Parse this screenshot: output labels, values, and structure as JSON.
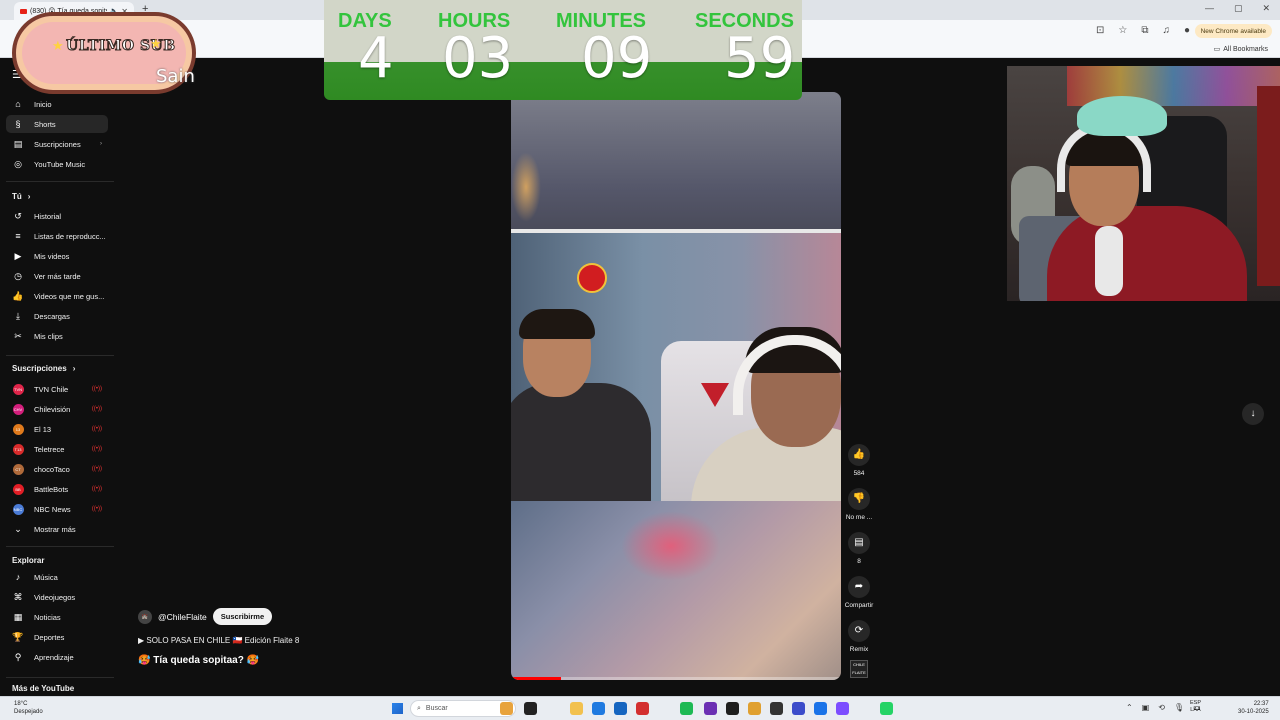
{
  "browser": {
    "tab_title": "(830) 😲 Tía queda sopitsa...",
    "new_chrome": "New Chrome available",
    "all_bookmarks": "All Bookmarks"
  },
  "overlay": {
    "badge_title": "ÚLTIMO SUB",
    "badge_name": "Sain",
    "countdown": {
      "days_label": "DAYS",
      "days": "4",
      "hours_label": "HOURS",
      "hours": "03",
      "minutes_label": "MINUTES",
      "minutes": "09",
      "seconds_label": "SECONDS",
      "seconds": "59"
    }
  },
  "sidebar": {
    "main": [
      {
        "label": "Inicio",
        "icon": "home-icon"
      },
      {
        "label": "Shorts",
        "icon": "shorts-icon"
      },
      {
        "label": "Suscripciones",
        "icon": "subscriptions-icon"
      },
      {
        "label": "YouTube Music",
        "icon": "music-icon"
      }
    ],
    "you_title": "Tú",
    "you": [
      {
        "label": "Historial",
        "icon": "history-icon"
      },
      {
        "label": "Listas de reproducc...",
        "icon": "playlist-icon"
      },
      {
        "label": "Mis videos",
        "icon": "video-icon"
      },
      {
        "label": "Ver más tarde",
        "icon": "clock-icon"
      },
      {
        "label": "Videos que me gus...",
        "icon": "like-icon"
      },
      {
        "label": "Descargas",
        "icon": "download-icon"
      },
      {
        "label": "Mis clips",
        "icon": "scissors-icon"
      }
    ],
    "subs_title": "Suscripciones",
    "subs": [
      {
        "label": "TVN Chile",
        "color": "#e0254a",
        "abbr": "TVN"
      },
      {
        "label": "Chilevisión",
        "color": "#d41e7c",
        "abbr": "CHV"
      },
      {
        "label": "El 13",
        "color": "#e07a1c",
        "abbr": "13"
      },
      {
        "label": "Teletrece",
        "color": "#d92b2b",
        "abbr": "T13"
      },
      {
        "label": "chocoTaco",
        "color": "#b06a3a",
        "abbr": "CT"
      },
      {
        "label": "BattleBots",
        "color": "#e21e26",
        "abbr": "BB"
      },
      {
        "label": "NBC News",
        "color": "#4a7bd6",
        "abbr": "NBC"
      }
    ],
    "show_more": "Mostrar más",
    "explore_title": "Explorar",
    "explore": [
      {
        "label": "Música",
        "icon": "music-note-icon"
      },
      {
        "label": "Videojuegos",
        "icon": "gamepad-icon"
      },
      {
        "label": "Noticias",
        "icon": "news-icon"
      },
      {
        "label": "Deportes",
        "icon": "trophy-icon"
      },
      {
        "label": "Aprendizaje",
        "icon": "bulb-icon"
      }
    ],
    "more_title": "Más de YouTube"
  },
  "short": {
    "channel": "@ChileFlaite",
    "subscribe": "Suscribirme",
    "playlist": "▶ SOLO PASA EN CHILE 🇨🇱 Edición Flaite 8",
    "title": "🥵 Tía queda sopitaa? 🥵",
    "progress": 0.15,
    "actions": {
      "likes": "584",
      "dislike": "No me ...",
      "comments": "8",
      "share": "Compartir",
      "remix": "Remix",
      "channel_avatar": "CHILE FLAITE"
    }
  },
  "taskbar": {
    "temp": "18°C",
    "weather": "Despejado",
    "search": "Buscar",
    "lang_top": "ESP",
    "lang_bottom": "LAA",
    "time": "22:37",
    "date": "30-10-2025"
  }
}
